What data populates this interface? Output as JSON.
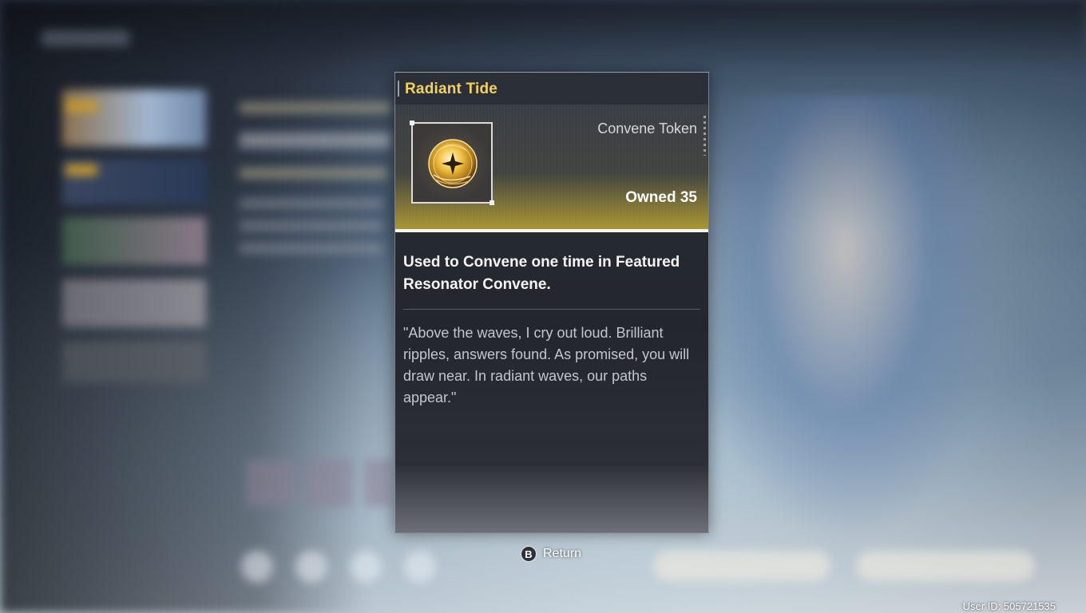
{
  "item_popup": {
    "title": "Radiant Tide",
    "item_type": "Convene Token",
    "owned_label": "Owned",
    "owned_count": "35",
    "description": "Used to Convene one time in Featured Resonator Convene.",
    "flavor_text": "\"Above the waves, I cry out loud. Brilliant ripples, answers found. As promised, you will draw near. In radiant waves, our paths appear.\"",
    "icon": "radiant-tide-token-icon",
    "title_color": "#f2d25a"
  },
  "footer": {
    "button_glyph": "B",
    "return_label": "Return",
    "user_id": "User ID: 505721535"
  }
}
